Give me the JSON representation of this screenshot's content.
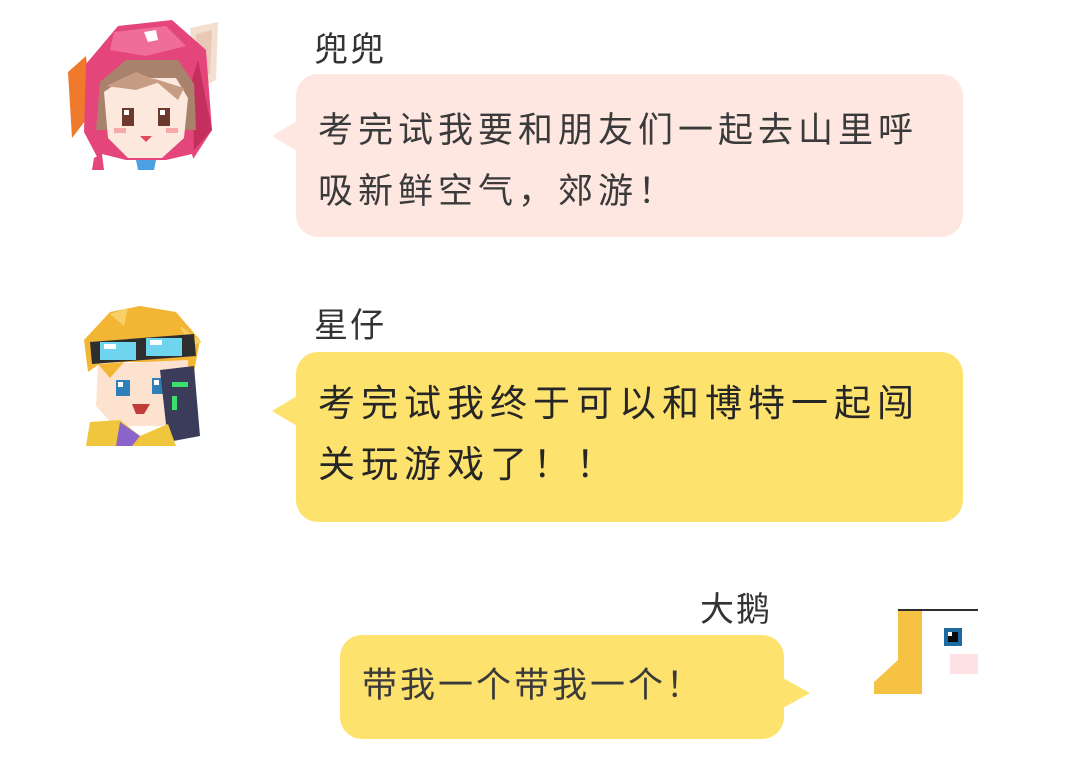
{
  "messages": [
    {
      "sender": "兜兜",
      "text": "考完试我要和朋友们一起去山里呼吸新鲜空气，郊游！",
      "avatar_icon": "pink-hooded-girl-avatar",
      "bubble_color": "#fde7e0"
    },
    {
      "sender": "星仔",
      "text": "考完试我终于可以和博特一起闯关玩游戏了！！",
      "avatar_icon": "goggles-boy-avatar",
      "bubble_color": "#fde26e"
    },
    {
      "sender": "大鹅",
      "text": "带我一个带我一个！",
      "avatar_icon": "white-goose-avatar",
      "bubble_color": "#fde26e"
    }
  ]
}
